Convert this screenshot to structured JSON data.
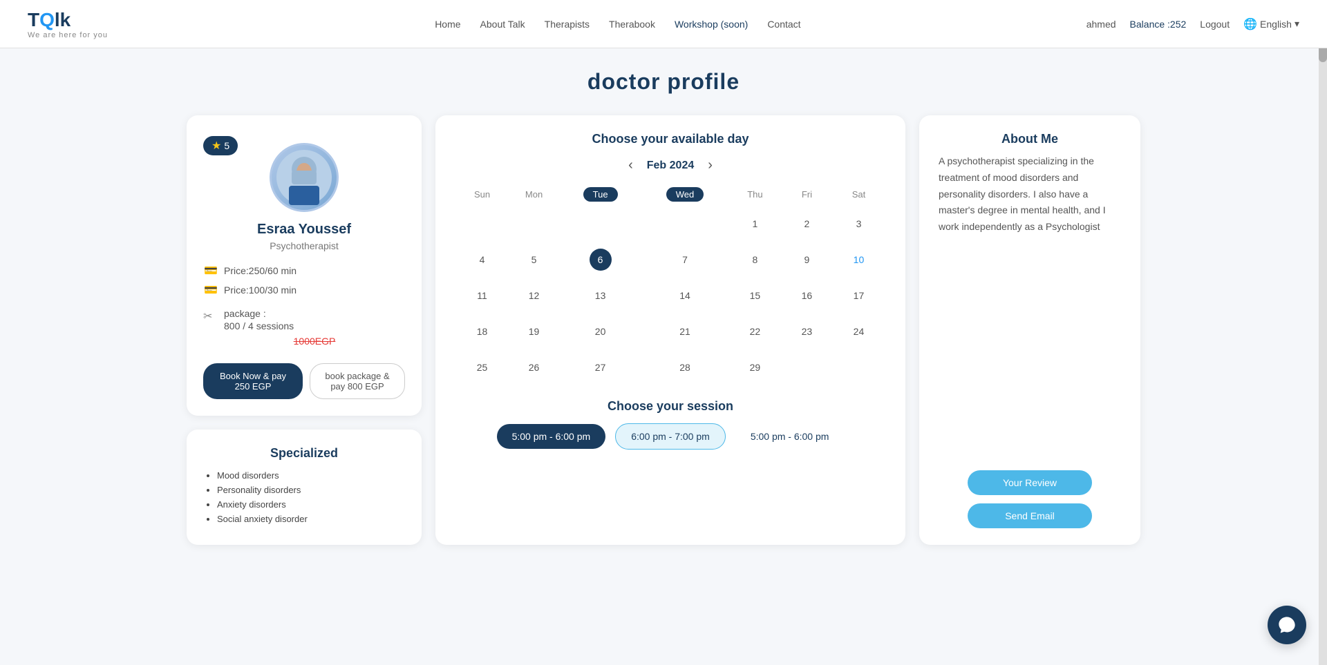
{
  "header": {
    "logo_title": "Talk",
    "logo_subtitle": "We are here for you",
    "nav": [
      {
        "label": "Home",
        "id": "home"
      },
      {
        "label": "About Talk",
        "id": "about"
      },
      {
        "label": "Therapists",
        "id": "therapists"
      },
      {
        "label": "Therabook",
        "id": "therabook"
      },
      {
        "label": "Workshop (soon)",
        "id": "workshop"
      },
      {
        "label": "Contact",
        "id": "contact"
      }
    ],
    "user": "ahmed",
    "balance_label": "Balance :252",
    "logout_label": "Logout",
    "lang_label": "English"
  },
  "page_title": "doctor profile",
  "doctor": {
    "name": "Esraa Youssef",
    "specialty": "Psychotherapist",
    "rating": "5",
    "price_60": "Price:250/60 min",
    "price_30": "Price:100/30 min",
    "package_label": "package :",
    "package_detail": "800 / 4 sessions",
    "original_price": "1000EGP",
    "btn_book_now": "Book Now & pay 250 EGP",
    "btn_package": "book package & pay 800 EGP"
  },
  "specialized": {
    "title": "Specialized",
    "items": [
      "Mood disorders",
      "Personality disorders",
      "Anxiety disorders",
      "Social anxiety disorder"
    ]
  },
  "calendar": {
    "title": "Choose your available day",
    "month": "Feb 2024",
    "days_of_week": [
      "Sun",
      "Mon",
      "Tue",
      "Wed",
      "Thu",
      "Fri",
      "Sat"
    ],
    "active_days": [
      "Tue",
      "Wed"
    ],
    "weeks": [
      [
        "",
        "",
        "",
        "",
        "1",
        "2",
        "3"
      ],
      [
        "4",
        "5",
        "6",
        "7",
        "8",
        "9",
        "10"
      ],
      [
        "11",
        "12",
        "13",
        "14",
        "15",
        "16",
        "17"
      ],
      [
        "18",
        "19",
        "20",
        "21",
        "22",
        "23",
        "24"
      ],
      [
        "25",
        "26",
        "27",
        "28",
        "29",
        "",
        ""
      ]
    ],
    "today": "6",
    "available": [
      "10"
    ]
  },
  "session": {
    "title": "Choose your session",
    "slots": [
      {
        "label": "5:00 pm - 6:00 pm",
        "type": "selected"
      },
      {
        "label": "6:00 pm - 7:00 pm",
        "type": "outline"
      },
      {
        "label": "5:00 pm - 6:00 pm",
        "type": "text"
      }
    ]
  },
  "about_me": {
    "title": "About Me",
    "text": "A psychotherapist specializing in the treatment of mood disorders and personality disorders. I also have a master's degree in mental health, and I work independently as a Psychologist",
    "btn_review": "Your Review",
    "btn_email": "Send Email"
  },
  "chat": {
    "icon": "chat-icon"
  }
}
